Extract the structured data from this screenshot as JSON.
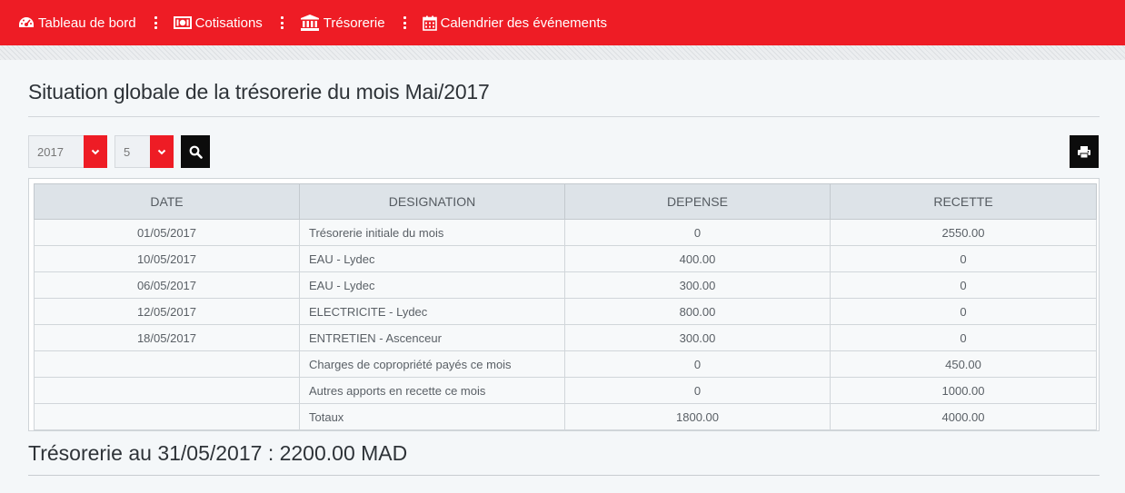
{
  "nav": {
    "items": [
      {
        "label": "Tableau de bord",
        "icon": "dashboard-icon"
      },
      {
        "label": "Cotisations",
        "icon": "money-icon"
      },
      {
        "label": "Trésorerie",
        "icon": "bank-icon"
      },
      {
        "label": "Calendrier des événements",
        "icon": "calendar-icon"
      }
    ]
  },
  "page": {
    "title": "Situation globale de la trésorerie du mois Mai/2017"
  },
  "filters": {
    "year": "2017",
    "month": "5"
  },
  "table": {
    "headers": [
      "DATE",
      "DESIGNATION",
      "DEPENSE",
      "RECETTE"
    ],
    "rows": [
      [
        "01/05/2017",
        "Trésorerie initiale du mois",
        "0",
        "2550.00"
      ],
      [
        "10/05/2017",
        "EAU - Lydec",
        "400.00",
        "0"
      ],
      [
        "06/05/2017",
        "EAU - Lydec",
        "300.00",
        "0"
      ],
      [
        "12/05/2017",
        "ELECTRICITE - Lydec",
        "800.00",
        "0"
      ],
      [
        "18/05/2017",
        "ENTRETIEN - Ascenceur",
        "300.00",
        "0"
      ],
      [
        "",
        "Charges de copropriété payés ce mois",
        "0",
        "450.00"
      ],
      [
        "",
        "Autres apports en recette ce mois",
        "0",
        "1000.00"
      ],
      [
        "",
        "Totaux",
        "1800.00",
        "4000.00"
      ]
    ]
  },
  "summary": {
    "text": "Trésorerie au 31/05/2017 : 2200.00 MAD"
  },
  "colors": {
    "accent": "#ee1c25",
    "dark_button": "#0c0c0c"
  }
}
